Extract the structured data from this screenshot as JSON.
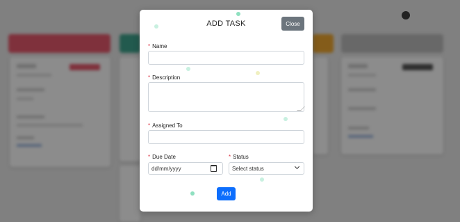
{
  "modal": {
    "title": "ADD TASK",
    "close_label": "Close",
    "fields": {
      "name": {
        "label": "Name",
        "required": "*",
        "value": ""
      },
      "description": {
        "label": "Description",
        "required": "*",
        "value": ""
      },
      "assigned_to": {
        "label": "Assigned To",
        "required": "*",
        "value": ""
      },
      "due_date": {
        "label": "Due Date",
        "required": "*",
        "placeholder": "dd/mm/yyyy"
      },
      "status": {
        "label": "Status",
        "required": "*",
        "selected": "Select status"
      }
    },
    "submit_label": "Add"
  },
  "icons": {
    "calendar": "calendar-icon",
    "dropdown": "chevron-down-icon",
    "add_task": "circle-icon"
  },
  "colors": {
    "column_1": "#e85a6e",
    "column_2": "#3fa48e",
    "column_3": "#f0a830",
    "column_4": "#9b9b9b",
    "close_button": "#6c757d",
    "add_button": "#0d6efd",
    "required": "#dc3545"
  }
}
